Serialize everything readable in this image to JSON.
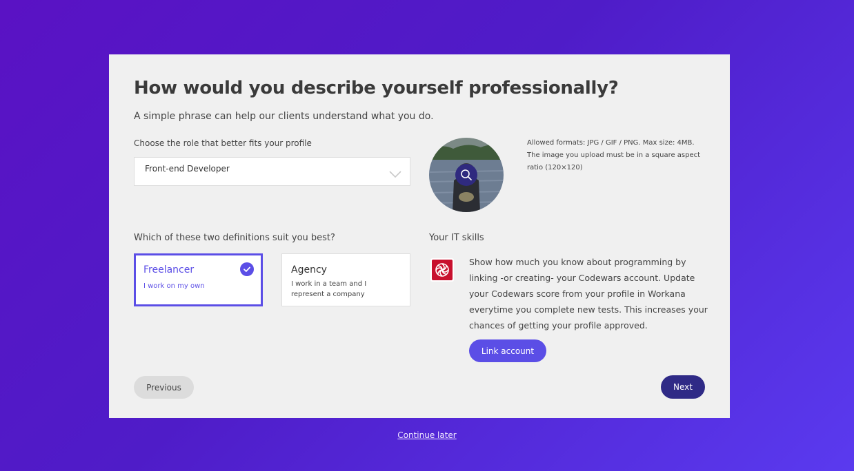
{
  "header": {
    "title": "How would you describe yourself professionally?",
    "subtitle": "A simple phrase can help our clients understand what you do."
  },
  "role": {
    "label": "Choose the role that better fits your profile",
    "selected": "Front-end Developer"
  },
  "photo": {
    "info": "Allowed formats: JPG / GIF / PNG. Max size: 4MB. The image you upload must be in a square aspect ratio (120×120)"
  },
  "definitions": {
    "question": "Which of these two definitions suit you best?",
    "options": [
      {
        "title": "Freelancer",
        "description": "I work on my own",
        "selected": true
      },
      {
        "title": "Agency",
        "description": "I work in a team and I represent a company",
        "selected": false
      }
    ]
  },
  "skills": {
    "title": "Your IT skills",
    "description": "Show how much you know about programming by linking -or creating- your Codewars account. Update your Codewars score from your profile in Workana everytime you complete new tests. This increases your chances of getting your profile approved.",
    "link_label": "Link account",
    "logo_icon": "codewars-logo-icon"
  },
  "nav": {
    "previous": "Previous",
    "next": "Next",
    "continue_later": "Continue later"
  },
  "colors": {
    "accent": "#5b4ee6",
    "primary_dark": "#2f2a86",
    "background_gradient_start": "#5a12c4",
    "background_gradient_end": "#5a3aef",
    "codewars_red": "#c8102e"
  }
}
